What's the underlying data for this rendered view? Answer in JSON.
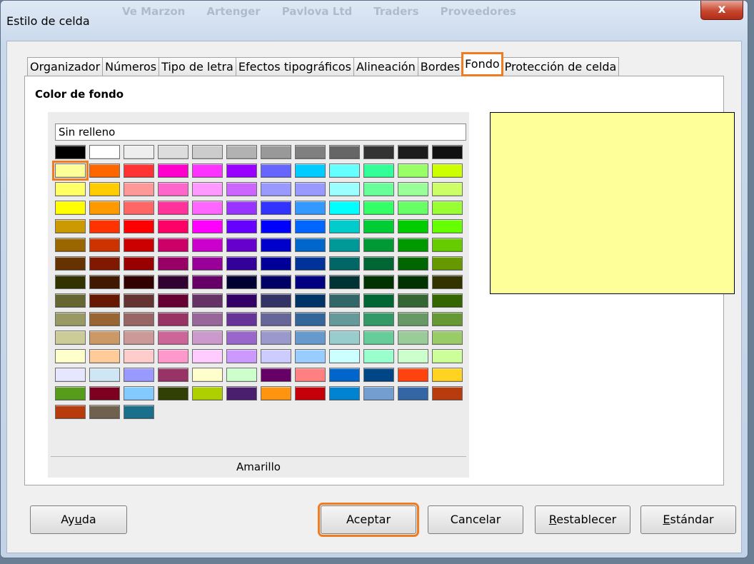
{
  "window": {
    "title": "Estilo de celda",
    "close_glyph": "x",
    "background_tabs": [
      "Ve Marzon",
      "Artenger",
      "Pavlova Ltd",
      "Traders",
      "Proveedores"
    ]
  },
  "tabs": [
    {
      "label": "Organizador",
      "active": false
    },
    {
      "label": "Números",
      "active": false
    },
    {
      "label": "Tipo de letra",
      "active": false
    },
    {
      "label": "Efectos tipográficos",
      "active": false
    },
    {
      "label": "Alineación",
      "active": false
    },
    {
      "label": "Bordes",
      "active": false
    },
    {
      "label": "Fondo",
      "active": true
    },
    {
      "label": "Protección de celda",
      "active": false
    }
  ],
  "background": {
    "section_label": "Color de fondo",
    "no_fill_label": "Sin relleno",
    "selected_color_name": "Amarillo",
    "selected_color": "#ffff99",
    "selected_index": 12
  },
  "palette": [
    "#000000",
    "#ffffff",
    "#eeeeee",
    "#dddddd",
    "#cccccc",
    "#b2b2b2",
    "#999999",
    "#808080",
    "#666666",
    "#333333",
    "#1c1c1c",
    "#111111",
    "#ffff99",
    "#ff6600",
    "#ff3333",
    "#ff00cc",
    "#ff33ff",
    "#9900ff",
    "#6666ff",
    "#00ccff",
    "#66ffff",
    "#33ff99",
    "#99ff66",
    "#ccff00",
    "#ffff66",
    "#ffcc00",
    "#ff9999",
    "#ff66cc",
    "#ff99ff",
    "#cc66ff",
    "#9999ff",
    "#9999ff",
    "#99ffff",
    "#66ff99",
    "#99ff99",
    "#ccff66",
    "#ffff00",
    "#ff9900",
    "#ff6666",
    "#ff3399",
    "#ff66ff",
    "#9933ff",
    "#3333ff",
    "#3399ff",
    "#00ffff",
    "#33ff66",
    "#66ff66",
    "#99ff33",
    "#cc9900",
    "#ff3300",
    "#ff0000",
    "#ff0066",
    "#ff00ff",
    "#6600ff",
    "#0000ff",
    "#0066ff",
    "#00cccc",
    "#00cc33",
    "#00cc00",
    "#66ff00",
    "#996600",
    "#cc3300",
    "#cc0000",
    "#cc0066",
    "#cc00cc",
    "#6600cc",
    "#0000cc",
    "#0066cc",
    "#009999",
    "#009933",
    "#009900",
    "#66cc00",
    "#663300",
    "#801900",
    "#990000",
    "#990066",
    "#990099",
    "#330099",
    "#000099",
    "#003399",
    "#006666",
    "#006633",
    "#006600",
    "#669900",
    "#333300",
    "#401900",
    "#330000",
    "#330033",
    "#660066",
    "#000033",
    "#000066",
    "#000080",
    "#003333",
    "#003300",
    "#003300",
    "#333300",
    "#666633",
    "#661900",
    "#663333",
    "#660033",
    "#663366",
    "#330066",
    "#333366",
    "#003366",
    "#336666",
    "#006633",
    "#336633",
    "#336600",
    "#999966",
    "#996633",
    "#996666",
    "#993366",
    "#996699",
    "#663399",
    "#666699",
    "#336699",
    "#669999",
    "#339966",
    "#669966",
    "#669933",
    "#cccc99",
    "#cc9966",
    "#cc9999",
    "#cc6699",
    "#cc99cc",
    "#9966cc",
    "#9999cc",
    "#6699cc",
    "#99cccc",
    "#66cc99",
    "#99cc99",
    "#99cc66",
    "#ffffcc",
    "#ffcc99",
    "#ffcccc",
    "#ff99cc",
    "#ffccff",
    "#cc99ff",
    "#ccccff",
    "#99ccff",
    "#ccffff",
    "#99ffcc",
    "#ccffcc",
    "#ccff99",
    "#e6e6ff",
    "#cfe7f5",
    "#9999ff",
    "#993366",
    "#ffffcc",
    "#ccffcc",
    "#660066",
    "#ff8080",
    "#0066cc",
    "#004586",
    "#ff420e",
    "#ffd320",
    "#579d1c",
    "#7e0021",
    "#83caff",
    "#314004",
    "#aecf00",
    "#4b1f6f",
    "#ff950e",
    "#c5000b",
    "#0084d1",
    "#729fcf",
    "#3465a4",
    "#b83b0e",
    "#b83b0e",
    "#706050",
    "#1a6f8a"
  ],
  "buttons": {
    "help": "Ayuda",
    "ok": "Aceptar",
    "cancel": "Cancelar",
    "reset": "Restablecer",
    "standard": "Estándar"
  }
}
